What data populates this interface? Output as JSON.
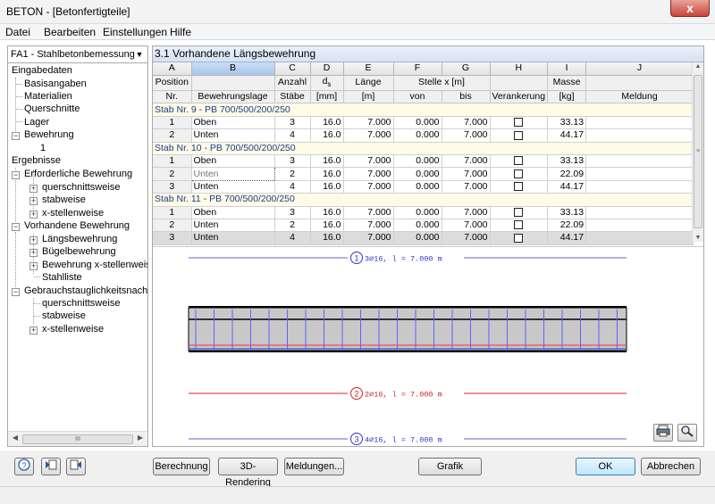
{
  "window": {
    "title": "BETON - [Betonfertigteile]",
    "close": "x"
  },
  "menu": [
    "Datei",
    "Bearbeiten",
    "Einstellungen",
    "Hilfe"
  ],
  "case_select": {
    "value": "FA1 - Stahlbetonbemessung voi",
    "arrow": "▼"
  },
  "tree": [
    "Eingabedaten",
    "Basisangaben",
    "Materialien",
    "Querschnitte",
    "Lager",
    "Bewehrung",
    "1",
    "Ergebnisse",
    "Erforderliche Bewehrung",
    "querschnittsweise",
    "stabweise",
    "x-stellenweise",
    "Vorhandene Bewehrung",
    "Längsbewehrung",
    "Bügelbewehrung",
    "Bewehrung x-stellenweise",
    "Stahlliste",
    "Gebrauchstauglichkeitsnachweis",
    "querschnittsweise",
    "stabweise",
    "x-stellenweise"
  ],
  "hscroll": {
    "left": "◀",
    "right": "▶",
    "grip": "III"
  },
  "panel": {
    "title": "3.1 Vorhandene Längsbewehrung"
  },
  "columns": {
    "letters": [
      "A",
      "B",
      "C",
      "D",
      "E",
      "F",
      "G",
      "H",
      "I",
      "J"
    ],
    "hdr1": [
      "Position",
      "",
      "Anzahl",
      "ds",
      "Länge",
      "Stelle x [m]",
      "",
      "Masse",
      ""
    ],
    "hdr2": [
      "Nr.",
      "Bewehrungslage",
      "Stäbe",
      "[mm]",
      "[m]",
      "von",
      "bis",
      "Verankerung",
      "[kg]",
      "Meldung"
    ]
  },
  "groups": [
    {
      "title": "Stab Nr. 9  -  PB 700/500/200/250",
      "rows": [
        [
          "1",
          "Oben",
          "3",
          "16.0",
          "7.000",
          "0.000",
          "7.000",
          "33.13"
        ],
        [
          "2",
          "Unten",
          "4",
          "16.0",
          "7.000",
          "0.000",
          "7.000",
          "44.17"
        ]
      ]
    },
    {
      "title": "Stab Nr. 10  -  PB 700/500/200/250",
      "rows": [
        [
          "1",
          "Oben",
          "3",
          "16.0",
          "7.000",
          "0.000",
          "7.000",
          "33.13"
        ],
        [
          "2",
          "Unten",
          "2",
          "16.0",
          "7.000",
          "0.000",
          "7.000",
          "22.09"
        ],
        [
          "3",
          "Unten",
          "4",
          "16.0",
          "7.000",
          "0.000",
          "7.000",
          "44.17"
        ]
      ]
    },
    {
      "title": "Stab Nr. 11  -  PB 700/500/200/250",
      "rows": [
        [
          "1",
          "Oben",
          "3",
          "16.0",
          "7.000",
          "0.000",
          "7.000",
          "33.13"
        ],
        [
          "2",
          "Unten",
          "2",
          "16.0",
          "7.000",
          "0.000",
          "7.000",
          "22.09"
        ],
        [
          "3",
          "Unten",
          "4",
          "16.0",
          "7.000",
          "0.000",
          "7.000",
          "44.17"
        ]
      ]
    }
  ],
  "graphic": {
    "labels": [
      {
        "num": "1",
        "text": "3⌀16, l = 7.000 m",
        "color": "#3333cc"
      },
      {
        "num": "2",
        "text": "2⌀16, l = 7.000 m",
        "color": "#cc2222"
      },
      {
        "num": "3",
        "text": "4⌀16, l = 7.000 m",
        "color": "#3333cc"
      }
    ],
    "colors": {
      "top_bar": "#8080e0",
      "bottom_bar": "#e05050",
      "concrete": "#c8c8c8",
      "stirrup": "#6060ff"
    }
  },
  "tools": {
    "print": "print-icon",
    "zoom": "zoom-icon"
  },
  "buttons": {
    "help": "?",
    "prev": "◀",
    "next": "▶",
    "berechnung": "Berechnung",
    "rendering": "3D-Rendering",
    "meldungen": "Meldungen...",
    "grafik": "Grafik",
    "ok": "OK",
    "abbrechen": "Abbrechen"
  }
}
